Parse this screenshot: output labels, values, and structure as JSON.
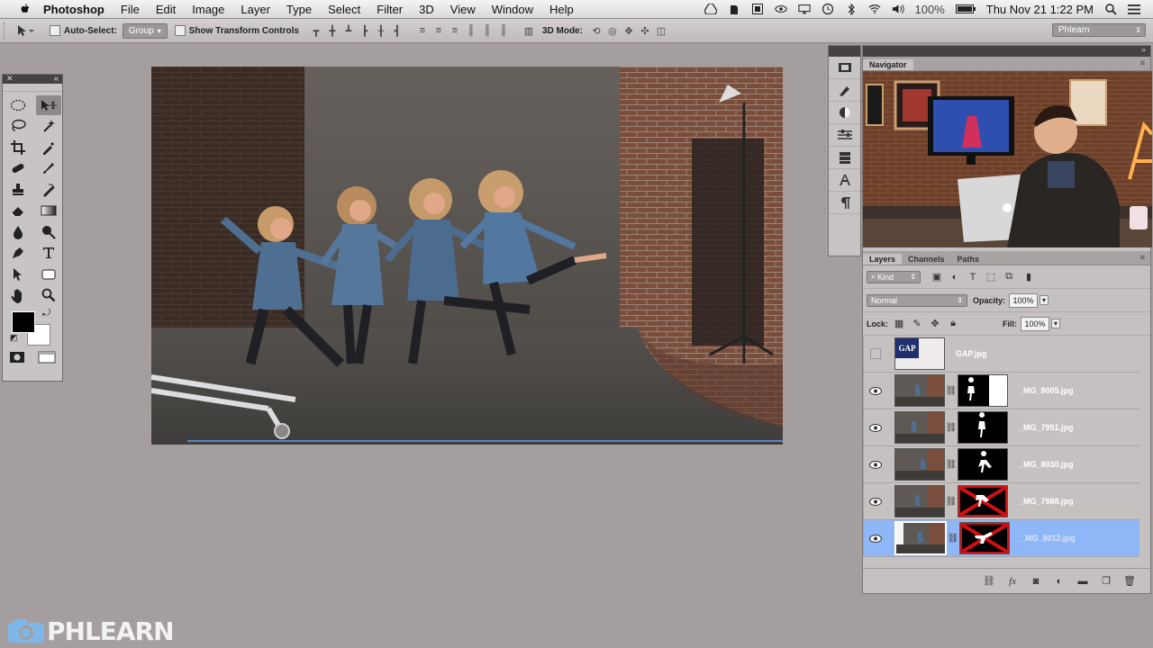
{
  "menubar": {
    "app_name": "Photoshop",
    "menus": [
      "File",
      "Edit",
      "Image",
      "Layer",
      "Type",
      "Select",
      "Filter",
      "3D",
      "View",
      "Window",
      "Help"
    ],
    "battery": "100%",
    "datetime": "Thu Nov 21  1:22 PM"
  },
  "options_bar": {
    "auto_select_label": "Auto-Select:",
    "auto_select_value": "Group",
    "show_transform_label": "Show Transform Controls",
    "mode_3d_label": "3D Mode:",
    "workspace": "Phlearn"
  },
  "navigator": {
    "tab_label": "Navigator"
  },
  "layers_panel": {
    "tabs": [
      "Layers",
      "Channels",
      "Paths"
    ],
    "filter_kind": "Kind",
    "blend_mode": "Normal",
    "opacity_label": "Opacity:",
    "opacity_value": "100%",
    "lock_label": "Lock:",
    "fill_label": "Fill:",
    "fill_value": "100%",
    "layers": [
      {
        "name": "GAP.jpg",
        "visible": false,
        "selected": false
      },
      {
        "name": "_MG_8005.jpg",
        "visible": true,
        "selected": false
      },
      {
        "name": "_MG_7951.jpg",
        "visible": true,
        "selected": false
      },
      {
        "name": "_MG_8030.jpg",
        "visible": true,
        "selected": false
      },
      {
        "name": "_MG_7988.jpg",
        "visible": true,
        "selected": false
      },
      {
        "name": "_MG_8012.jpg",
        "visible": true,
        "selected": true
      }
    ],
    "gap_thumb_text": "GAP"
  },
  "watermark": {
    "text": "PHLEARN"
  },
  "colors": {
    "canvas_bg": "#a59e9e",
    "selection_blue": "#8fb6f6",
    "mask_red": "#d01010"
  }
}
